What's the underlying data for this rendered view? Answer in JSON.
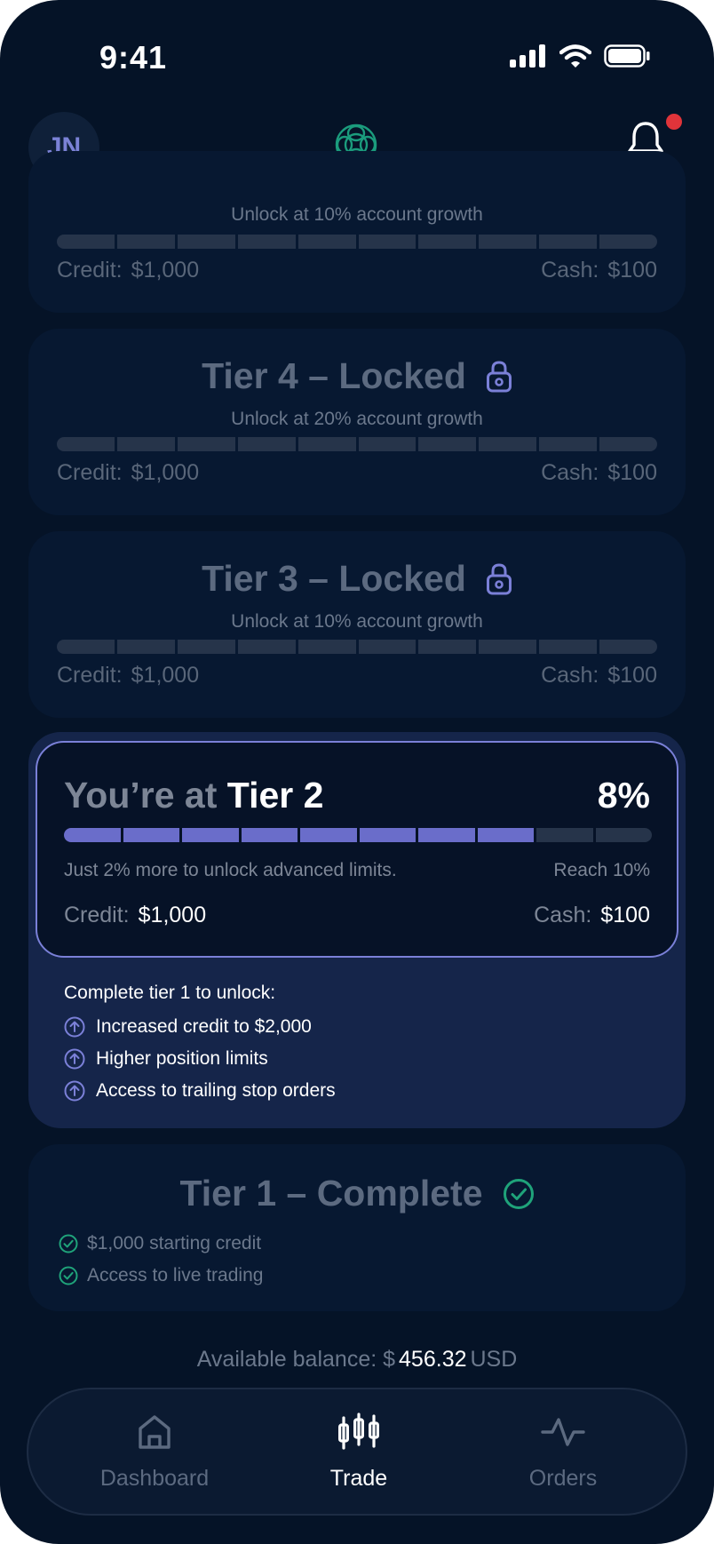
{
  "status_bar": {
    "time": "9:41"
  },
  "header": {
    "avatar_initials": "JN"
  },
  "tiers": {
    "tier5": {
      "subtitle": "Unlock at 10% account growth",
      "credit_label": "Credit:",
      "credit_value": "$1,000",
      "cash_label": "Cash:",
      "cash_value": "$100"
    },
    "tier4": {
      "title": "Tier 4 – Locked",
      "subtitle": "Unlock at 20% account growth",
      "credit_label": "Credit:",
      "credit_value": "$1,000",
      "cash_label": "Cash:",
      "cash_value": "$100"
    },
    "tier3": {
      "title": "Tier 3 – Locked",
      "subtitle": "Unlock at 10% account growth",
      "credit_label": "Credit:",
      "credit_value": "$1,000",
      "cash_label": "Cash:",
      "cash_value": "$100"
    }
  },
  "current": {
    "title_prefix": "You’re at",
    "title_tier": "Tier 2",
    "percent": "8%",
    "progress_fraction": 0.8,
    "message": "Just 2% more to unlock advanced limits.",
    "reach": "Reach 10%",
    "credit_label": "Credit:",
    "credit_value": "$1,000",
    "cash_label": "Cash:",
    "cash_value": "$100",
    "unlock_heading": "Complete tier 1 to unlock:",
    "unlock_items": [
      "Increased credit to $2,000",
      "Higher position limits",
      "Access to trailing stop orders"
    ]
  },
  "tier1": {
    "title": "Tier 1 – Complete",
    "items": [
      "$1,000 starting credit",
      "Access to live trading"
    ]
  },
  "balance": {
    "label": "Available balance:",
    "currency_symbol": "$",
    "amount": "456.32",
    "currency": "USD"
  },
  "nav": {
    "items": [
      {
        "label": "Dashboard",
        "icon": "home-icon",
        "active": false
      },
      {
        "label": "Trade",
        "icon": "candlestick-icon",
        "active": true
      },
      {
        "label": "Orders",
        "icon": "activity-icon",
        "active": false
      }
    ]
  },
  "colors": {
    "background": "#051327",
    "accent": "#6a6dca",
    "success": "#1fa37a",
    "notification": "#e0343a"
  }
}
